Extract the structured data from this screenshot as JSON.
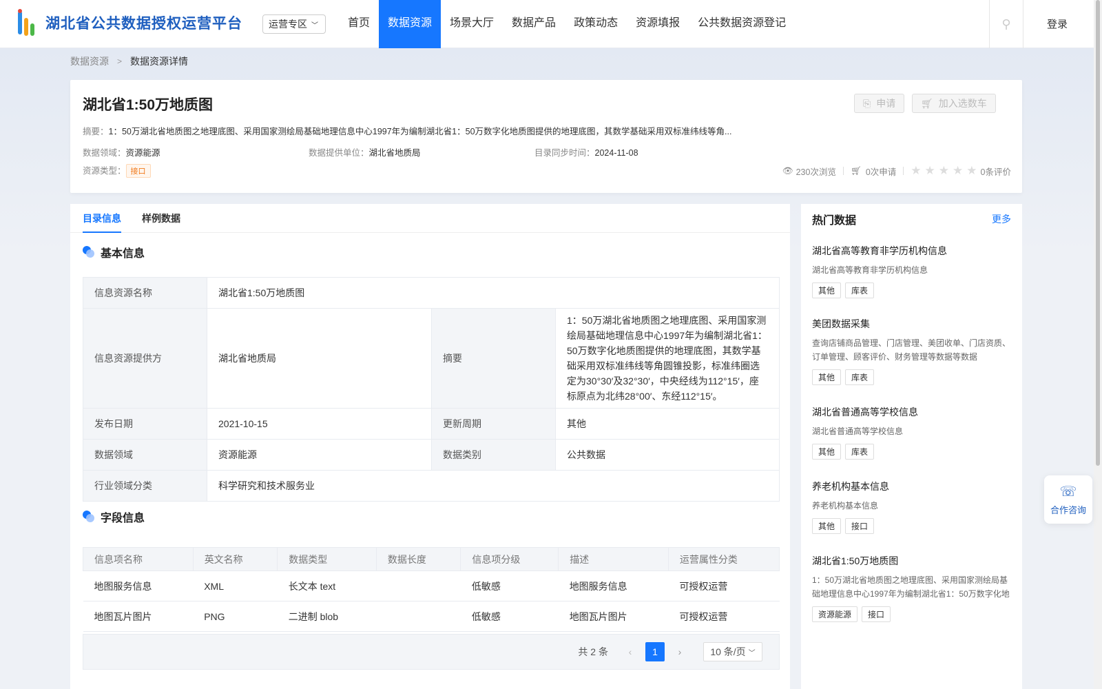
{
  "header": {
    "logo_text": "湖北省公共数据授权运营平台",
    "dropdown": "运营专区",
    "nav": [
      "首页",
      "数据资源",
      "场景大厅",
      "数据产品",
      "政策动态",
      "资源填报",
      "公共数据资源登记"
    ],
    "login": "登录"
  },
  "breadcrumb": [
    "数据资源",
    "数据资源详情"
  ],
  "detail": {
    "title": "湖北省1:50万地质图",
    "apply": "申请",
    "cart": "加入选数车",
    "summary_label": "摘要：",
    "summary": "1：50万湖北省地质图之地理底图、采用国家测绘局基础地理信息中心1997年为编制湖北省1：50万数字化地质图提供的地理底图，其数学基础采用双标准纬线等角...",
    "domain_label": "数据领域：",
    "domain": "资源能源",
    "provider_label": "数据提供单位：",
    "provider": "湖北省地质局",
    "sync_label": "目录同步时间：",
    "sync": "2024-11-08",
    "type_label": "资源类型：",
    "type": "接口",
    "views": "230次浏览",
    "applies": "0次申请",
    "reviews": "0条评价"
  },
  "tabs": [
    "目录信息",
    "样例数据"
  ],
  "basic": {
    "title": "基本信息",
    "name_k": "信息资源名称",
    "name_v": "湖北省1:50万地质图",
    "prov_k": "信息资源提供方",
    "prov_v": "湖北省地质局",
    "abs_k": "摘要",
    "abs_v": "1：50万湖北省地质图之地理底图、采用国家测绘局基础地理信息中心1997年为编制湖北省1：50万数字化地质图提供的地理底图，其数学基础采用双标准纬线等角圆锥投影，标准纬圈选定为30°30′及32°30′，中央经线为112°15′，座标原点为北纬28°00′、东经112°15′。",
    "date_k": "发布日期",
    "date_v": "2021-10-15",
    "cycle_k": "更新周期",
    "cycle_v": "其他",
    "dom_k": "数据领域",
    "dom_v": "资源能源",
    "cat_k": "数据类别",
    "cat_v": "公共数据",
    "ind_k": "行业领域分类",
    "ind_v": "科学研究和技术服务业"
  },
  "fields": {
    "title": "字段信息",
    "headers": [
      "信息项名称",
      "英文名称",
      "数据类型",
      "数据长度",
      "信息项分级",
      "描述",
      "运营属性分类"
    ],
    "rows": [
      [
        "地图服务信息",
        "XML",
        "长文本 text",
        "",
        "低敏感",
        "地图服务信息",
        "可授权运营"
      ],
      [
        "地图瓦片图片",
        "PNG",
        "二进制 blob",
        "",
        "低敏感",
        "地图瓦片图片",
        "可授权运营"
      ]
    ],
    "total": "共 2 条",
    "page": "1",
    "page_size": "10 条/页"
  },
  "hot": {
    "title": "热门数据",
    "more": "更多",
    "items": [
      {
        "name": "湖北省高等教育非学历机构信息",
        "desc": "湖北省高等教育非学历机构信息",
        "tags": [
          "其他",
          "库表"
        ]
      },
      {
        "name": "美团数据采集",
        "desc": "查询店铺商品管理、门店管理、美团收单、门店资质、订单管理、顾客评价、财务管理等数据等数据",
        "tags": [
          "其他",
          "库表"
        ]
      },
      {
        "name": "湖北省普通高等学校信息",
        "desc": "湖北省普通高等学校信息",
        "tags": [
          "其他",
          "库表"
        ]
      },
      {
        "name": "养老机构基本信息",
        "desc": "养老机构基本信息",
        "tags": [
          "其他",
          "接口"
        ]
      },
      {
        "name": "湖北省1:50万地质图",
        "desc": "1：50万湖北省地质图之地理底图、采用国家测绘局基础地理信息中心1997年为编制湖北省1：50万数字化地",
        "tags": [
          "资源能源",
          "接口"
        ]
      }
    ]
  },
  "consult": "合作咨询"
}
